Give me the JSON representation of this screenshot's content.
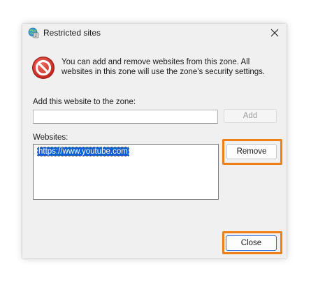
{
  "window": {
    "title": "Restricted sites",
    "title_icon": "globe-shield-icon",
    "close_icon": "close-icon"
  },
  "info": {
    "icon": "stop-icon",
    "text": "You can add and remove websites from this zone. All websites in this zone will use the zone's security settings."
  },
  "add_section": {
    "label": "Add this website to the zone:",
    "input_value": "",
    "add_button": "Add"
  },
  "websites_section": {
    "label": "Websites:",
    "items": [
      "https://www.youtube.com"
    ],
    "remove_button": "Remove"
  },
  "footer": {
    "close_button": "Close"
  },
  "colors": {
    "highlight": "#f07f15",
    "selection": "#0f5fd1",
    "dialog_bg": "#f0f0f0",
    "stop_red": "#d9302b"
  }
}
